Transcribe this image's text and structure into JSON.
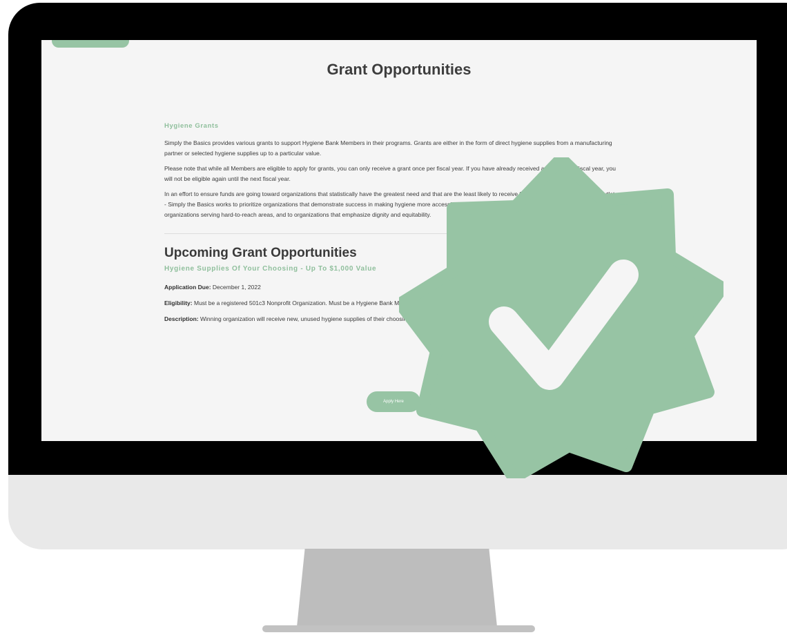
{
  "page": {
    "title": "Grant Opportunities"
  },
  "hygiene": {
    "heading": "Hygiene Grants",
    "paragraphs": [
      "Simply the Basics provides various grants to support Hygiene Bank Members in their programs. Grants are either in the form of direct hygiene supplies from a manufacturing partner or selected hygiene supplies up to a particular value.",
      "Please note that while all Members are eligible to apply for grants, you can only receive a grant once per fiscal year. If you have already received a grant in the fiscal year, you will not be eligible again until the next fiscal year.",
      "In an effort to ensure funds are going toward organizations that statistically have the greatest need and that are the least likely to receive financial support through other outlets - Simply the Basics works to prioritize organizations that demonstrate success in making hygiene more accessible to communities that would otherwise go without, to organizations serving hard-to-reach areas, and to organizations that emphasize dignity and equitability."
    ]
  },
  "upcoming": {
    "heading": "Upcoming Grant Opportunities",
    "opportunity_title": "Hygiene Supplies Of Your Choosing - Up To $1,000 Value",
    "due_label": "Application Due:",
    "due_value": "December 1, 2022",
    "eligibility_label": "Eligibility:",
    "eligibility_value": "Must be a registered 501c3 Nonprofit Organization. Must be a Hygiene Bank Member in good standing.",
    "description_label": "Description:",
    "description_value": "Winning organization will receive new, unused hygiene supplies of their choosing with a value of up to $1,000.",
    "apply_label": "Apply Here"
  },
  "colors": {
    "accent_green": "#97c4a4",
    "bezel": "#000000",
    "screen_bg": "#f5f5f5",
    "chin": "#e9e9e9",
    "stand": "#bdbdbd"
  },
  "icons": {
    "badge": "verified-check-badge-icon"
  }
}
